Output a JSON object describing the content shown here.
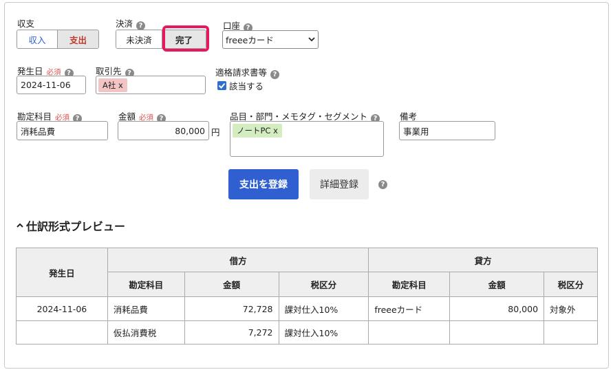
{
  "form": {
    "type": {
      "label": "収支",
      "options": [
        "収入",
        "支出"
      ],
      "selected": "支出"
    },
    "settlement": {
      "label": "決済",
      "options": [
        "未決済",
        "完了"
      ],
      "selected": "完了"
    },
    "account": {
      "label": "口座",
      "value": "freeeカード"
    },
    "date": {
      "label": "発生日",
      "required": "必須",
      "value": "2024-11-06"
    },
    "partner": {
      "label": "取引先",
      "tag": "A社",
      "tag_remove": "x"
    },
    "invoice": {
      "label": "適格請求書等",
      "checkbox_label": "該当する",
      "checked": true
    },
    "account_item": {
      "label": "勘定科目",
      "required": "必須",
      "value": "消耗品費"
    },
    "amount": {
      "label": "金額",
      "required": "必須",
      "value": "80,000",
      "unit": "円"
    },
    "tags": {
      "label": "品目・部門・メモタグ・セグメント",
      "tag": "ノートPC",
      "tag_remove": "x"
    },
    "note": {
      "label": "備考",
      "value": "事業用"
    },
    "buttons": {
      "register": "支出を登録",
      "detail": "詳細登録"
    }
  },
  "preview": {
    "title": "仕訳形式プレビュー",
    "headers": {
      "date": "発生日",
      "debit": "借方",
      "credit": "貸方",
      "sub": [
        "勘定科目",
        "金額",
        "税区分",
        "勘定科目",
        "金額",
        "税区分"
      ]
    },
    "rows": [
      [
        "2024-11-06",
        "消耗品費",
        "72,728",
        "課対仕入10%",
        "freeeカード",
        "80,000",
        "対象外"
      ],
      [
        "",
        "仮払消費税",
        "7,272",
        "課対仕入10%",
        "",
        "",
        ""
      ]
    ]
  },
  "colors": {
    "primary": "#2f5fd0",
    "highlight": "#e8185f",
    "partner_tag": "#f2c4c4",
    "item_tag": "#d3ecc0",
    "required": "#d9534f",
    "income_text": "#2f5fd0",
    "expense_text": "#c0392b"
  }
}
